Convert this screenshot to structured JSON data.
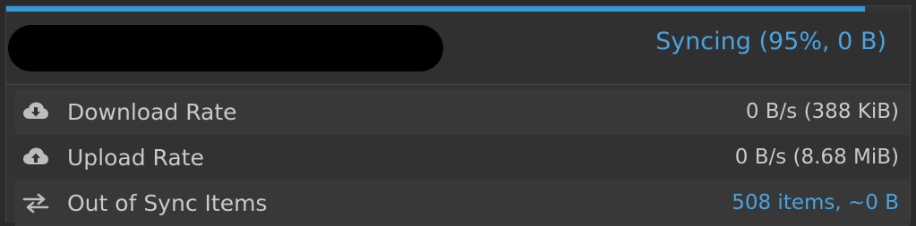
{
  "header": {
    "status_text": "Syncing (95%, 0 B)",
    "progress": 0.95,
    "accent_color": "#3498db"
  },
  "rows": [
    {
      "icon": "cloud-download-icon",
      "label": "Download Rate",
      "value": "0 B/s (388 KiB)"
    },
    {
      "icon": "cloud-upload-icon",
      "label": "Upload Rate",
      "value": "0 B/s (8.68 MiB)"
    },
    {
      "icon": "swap-arrows-icon",
      "label": "Out of Sync Items",
      "value": "508 items, ~0 B"
    }
  ]
}
